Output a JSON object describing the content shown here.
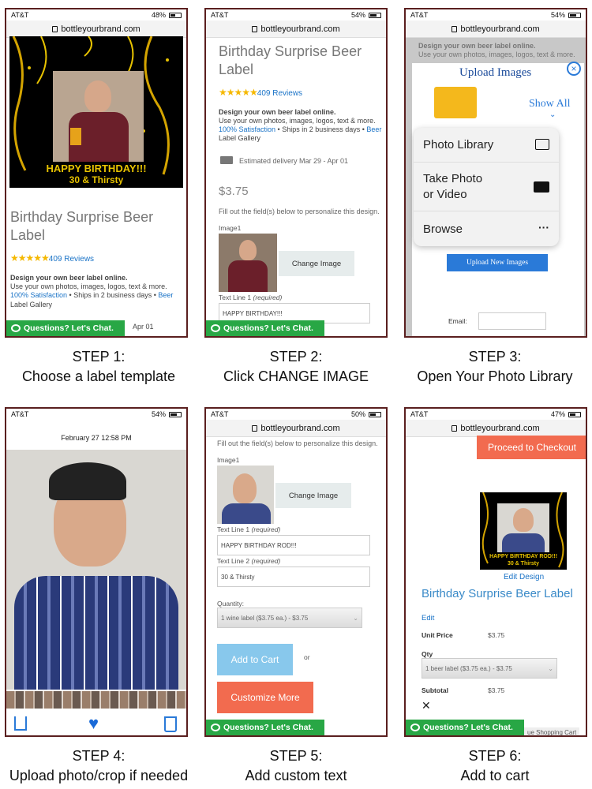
{
  "phones": [
    {
      "carrier": "AT&T",
      "battery": "48%",
      "url": "bottleyourbrand.com"
    },
    {
      "carrier": "AT&T",
      "battery": "54%",
      "url": "bottleyourbrand.com"
    },
    {
      "carrier": "AT&T",
      "battery": "54%",
      "url": "bottleyourbrand.com"
    },
    {
      "carrier": "AT&T",
      "battery": "54%",
      "url": ""
    },
    {
      "carrier": "AT&T",
      "battery": "50%",
      "url": "bottleyourbrand.com"
    },
    {
      "carrier": "AT&T",
      "battery": "47%",
      "url": "bottleyourbrand.com"
    }
  ],
  "chat_label": "Questions? Let's Chat.",
  "product": {
    "title": "Birthday Surprise Beer Label",
    "reviews": "409 Reviews",
    "design_line": "Design your own beer label online.",
    "use_line": "Use your own photos, images, logos, text & more.",
    "satisfaction": "100% Satisfaction",
    "ships": " • Ships in 2 business days • ",
    "gallery": "Beer Label Gallery",
    "gallery_a": "Beer",
    "gallery_b": "Label Gallery",
    "price": "$3.75",
    "delivery": "Estimated delivery Mar 29 - Apr 01",
    "delivery_tail": "Apr 01",
    "fill_out": "Fill out the field(s) below to personalize this design.",
    "image_label": "Image1",
    "change_image": "Change Image",
    "text1_label": "Text Line 1",
    "text2_label": "Text Line 2",
    "required": "(required)",
    "text1_value_a": "HAPPY BIRTHDAY!!!",
    "text1_value_b": "HAPPY BIRTHDAY ROD!!!",
    "text2_value": "30 & Thirsty",
    "quantity_label": "Quantity:",
    "quantity_value": "1 wine label ($3.75 ea.) - $3.75",
    "add_to_cart": "Add to Cart",
    "or": "or",
    "customize_more": "Customize More",
    "banner_line1": "HAPPY BIRTHDAY!!!",
    "banner_line2": "30 & Thirsty"
  },
  "upload_dialog": {
    "title": "Upload Images",
    "show_all": "Show All",
    "menu": [
      "Photo Library",
      "Take Photo\nor Video",
      "Browse"
    ],
    "upload_button": "Upload New Images",
    "email_label": "Email:"
  },
  "photo_view": {
    "date": "February 27  12:58 PM"
  },
  "cart": {
    "checkout": "Proceed to Checkout",
    "edit_design": "Edit Design",
    "title": "Birthday Surprise Beer Label",
    "edit": "Edit",
    "unit_price_label": "Unit Price",
    "unit_price": "$3.75",
    "qty_label": "Qty",
    "qty_value": "1 beer label ($3.75 ea.) - $3.75",
    "subtotal_label": "Subtotal",
    "subtotal": "$3.75",
    "continue": "ue Shopping Cart"
  },
  "steps": [
    {
      "n": "STEP 1:",
      "t": "Choose a label template"
    },
    {
      "n": "STEP 2:",
      "t": "Click CHANGE IMAGE"
    },
    {
      "n": "STEP 3:",
      "t": "Open Your Photo Library"
    },
    {
      "n": "STEP 4:",
      "t": "Upload photo/crop if needed"
    },
    {
      "n": "STEP 5:",
      "t": "Add custom text"
    },
    {
      "n": "STEP 6:",
      "t": "Add to cart"
    }
  ],
  "colors": {
    "frame": "#5a1f1f",
    "chat": "#28a745",
    "link": "#1a73c7",
    "accent": "#f26b4f",
    "add_cart": "#88c8ec",
    "stars": "#f5b800"
  }
}
